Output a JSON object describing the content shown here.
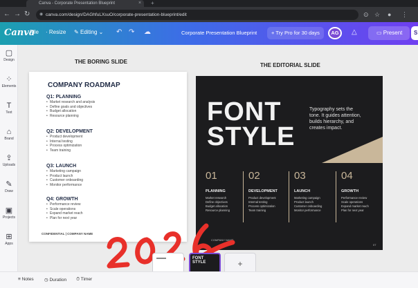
{
  "browser": {
    "tab_title": "Canva - Corporate Presentation Blueprint",
    "url": "canva.com/design/DAGhfuLXsuO/corporate-presentation-blueprint/edit",
    "icons": [
      "back-arrow-icon",
      "forward-arrow-icon",
      "reload-icon",
      "lock-icon",
      "share-icon",
      "star-icon",
      "profile-icon",
      "menu-icon"
    ]
  },
  "topbar": {
    "logo": "Canva",
    "file_label": "File",
    "resize_label": "Resize",
    "editing_label": "Editing",
    "doc_title": "Corporate Presentation Blueprint",
    "try_pro_label": "Try Pro for 30 days",
    "avatar_initials": "AG",
    "present_label": "Present",
    "share_label": "S",
    "accent_start": "#1c9fb0",
    "accent_end": "#6f3ff0"
  },
  "sidebar": {
    "items": [
      {
        "label": "Design",
        "icon": "design-icon"
      },
      {
        "label": "Elements",
        "icon": "elements-icon"
      },
      {
        "label": "Text",
        "icon": "text-icon"
      },
      {
        "label": "Brand",
        "icon": "brand-icon"
      },
      {
        "label": "Uploads",
        "icon": "uploads-icon"
      },
      {
        "label": "Draw",
        "icon": "draw-icon"
      },
      {
        "label": "Projects",
        "icon": "projects-icon"
      },
      {
        "label": "Apps",
        "icon": "apps-icon"
      }
    ]
  },
  "canvas": {
    "boring_label": "THE BORING SLIDE",
    "editorial_label": "THE EDITORIAL SLIDE"
  },
  "boring_slide": {
    "title": "COMPANY ROADMAP",
    "sections": [
      {
        "heading": "Q1: PLANNING",
        "items": [
          "Market research and analysis",
          "Define goals and objectives",
          "Budget allocation",
          "Resource planning"
        ]
      },
      {
        "heading": "Q2: DEVELOPMENT",
        "items": [
          "Product development",
          "Internal testing",
          "Process optimization",
          "Team training"
        ]
      },
      {
        "heading": "Q3: LAUNCH",
        "items": [
          "Marketing campaign",
          "Product launch",
          "Customer onboarding",
          "Monitor performance"
        ]
      },
      {
        "heading": "Q4: GROWTH",
        "items": [
          "Performance review",
          "Scale operations",
          "Expand market reach",
          "Plan for next year"
        ]
      }
    ],
    "footer": "CONFIDENTIAL | COMPANY NAME"
  },
  "editorial_slide": {
    "title_line1": "FONT",
    "title_line2": "STYLE",
    "description": "Typography sets the tone. It guides attention, builds hierarchy, and creates impact.",
    "accent_color": "#c9b79a",
    "columns": [
      {
        "number": "01",
        "title": "PLANNING",
        "items": [
          "Market research",
          "Define objectives",
          "Budget allocation",
          "Resource planning"
        ]
      },
      {
        "number": "02",
        "title": "DEVELOPMENT",
        "items": [
          "Product development",
          "Internal testing",
          "Process optimization",
          "Team training"
        ]
      },
      {
        "number": "03",
        "title": "LAUNCH",
        "items": [
          "Marketing campaign",
          "Product launch",
          "Customer onboarding",
          "Monitor performance"
        ]
      },
      {
        "number": "04",
        "title": "GROWTH",
        "items": [
          "Performance review",
          "Scale operations",
          "Expand market reach",
          "Plan for next year"
        ]
      }
    ],
    "footer": "COMPANY NAME",
    "page_number": "07"
  },
  "annotation": {
    "text": "2026",
    "color": "#e8302a"
  },
  "thumbnails": {
    "thumb2_line1": "FONT",
    "thumb2_line2": "STYLE",
    "add_label": "+"
  },
  "bottombar": {
    "notes_label": "Notes",
    "duration_label": "Duration",
    "timer_label": "Timer"
  }
}
